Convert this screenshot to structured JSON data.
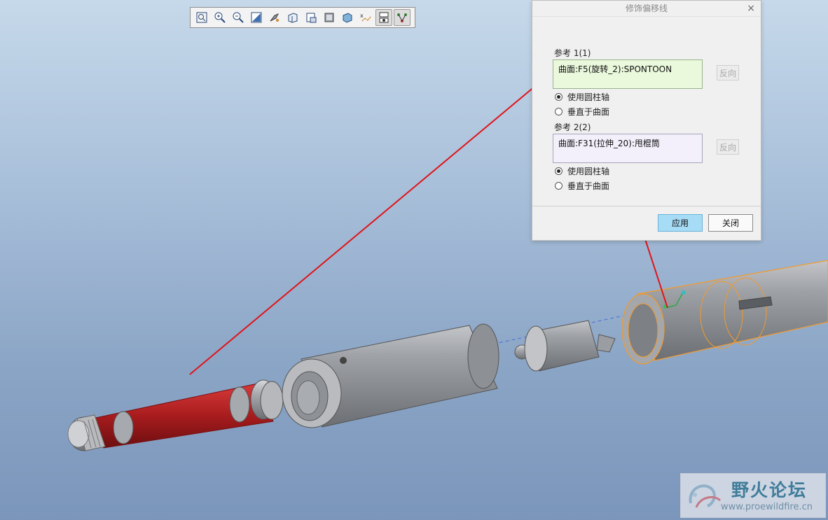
{
  "toolbar": {
    "icons": [
      "zoom-fit-icon",
      "zoom-in-icon",
      "zoom-out-icon",
      "repaint-icon",
      "spin-center-icon",
      "view-orient-icon",
      "saved-views-icon",
      "display-style-icon",
      "view-manager-icon",
      "datum-display-icon",
      "annotation-display-icon",
      "cosmetic-offset-icon"
    ]
  },
  "dialog": {
    "title": "修饰偏移线",
    "close_glyph": "×",
    "ref1": {
      "label": "参考 1(1)",
      "value": "曲面:F5(旋转_2):SPONTOON",
      "flip": "反向"
    },
    "ref1_options": [
      "使用圆柱轴",
      "垂直于曲面"
    ],
    "ref2": {
      "label": "参考 2(2)",
      "value": "曲面:F31(拉伸_20):甩棍筒",
      "flip": "反向"
    },
    "ref2_options": [
      "使用圆柱轴",
      "垂直于曲面"
    ],
    "apply": "应用",
    "close": "关闭"
  },
  "watermark": {
    "cn": "野火论坛",
    "url": "www.proewildfire.cn"
  },
  "colors": {
    "accent": "#a7dcf6",
    "highlight_red": "#b41d1f",
    "selection_orange": "#f39a2d",
    "arrow": "#e0141a"
  }
}
